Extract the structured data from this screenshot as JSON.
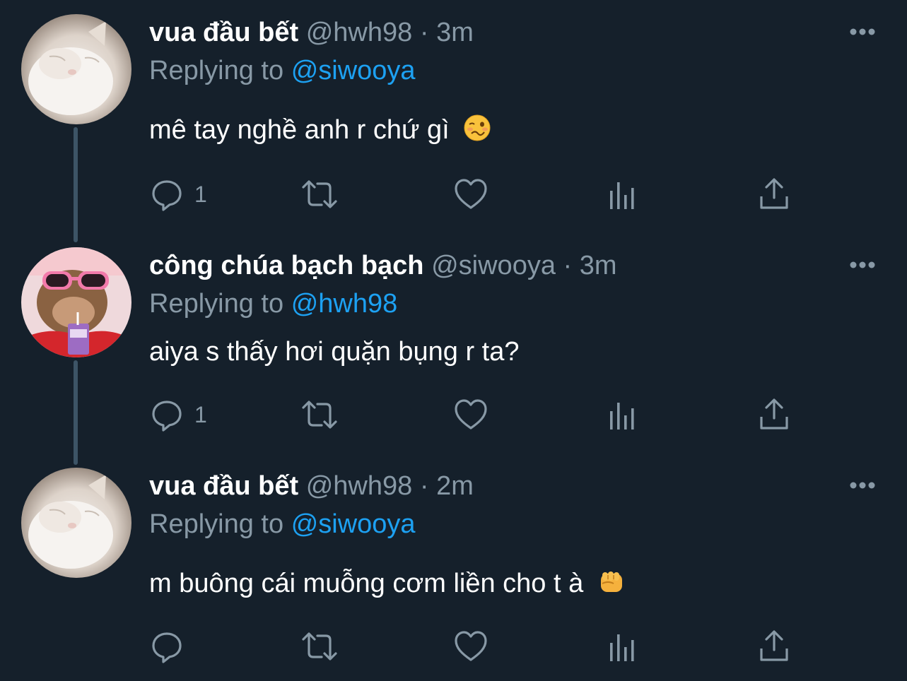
{
  "colors": {
    "background": "#15202b",
    "text_primary": "#ffffff",
    "text_secondary": "#8899a6",
    "accent": "#1da1f2",
    "thread_line": "#3d5466"
  },
  "tweets": [
    {
      "name": "vua đầu bết",
      "handle": "@hwh98",
      "separator": "·",
      "time": "3m",
      "replying_prefix": "Replying to",
      "replying_to": "@siwooya",
      "text": "mê tay nghề anh r chứ gì",
      "emoji": "woozy-face-emoji",
      "avatar": "white-cat-avatar",
      "reply_count": "1"
    },
    {
      "name": "công chúa bạch bạch",
      "handle": "@siwooya",
      "separator": "·",
      "time": "3m",
      "replying_prefix": "Replying to",
      "replying_to": "@hwh98",
      "text": "aiya s thấy hơi quặn bụng r ta?",
      "emoji": "",
      "avatar": "monkey-sunglasses-avatar",
      "reply_count": "1"
    },
    {
      "name": "vua đầu bết",
      "handle": "@hwh98",
      "separator": "·",
      "time": "2m",
      "replying_prefix": "Replying to",
      "replying_to": "@siwooya",
      "text": "m buông cái muỗng cơm liền cho t à",
      "emoji": "oncoming-fist-emoji",
      "avatar": "white-cat-avatar",
      "reply_count": ""
    }
  ],
  "icons": {
    "more": "more-options-icon",
    "reply": "reply-icon",
    "retweet": "retweet-icon",
    "like": "like-icon",
    "analytics": "analytics-icon",
    "share": "share-icon"
  }
}
